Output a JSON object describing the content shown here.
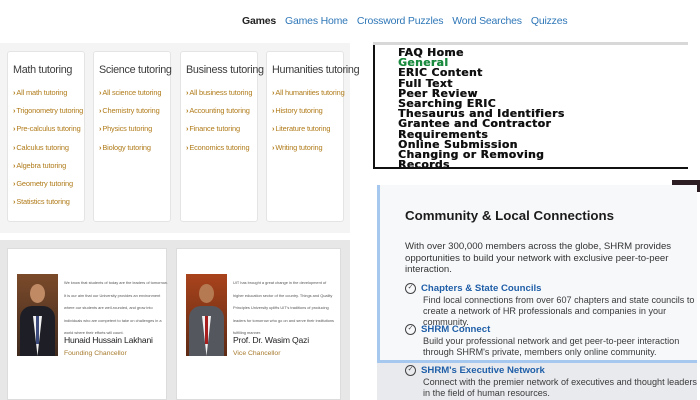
{
  "nav": {
    "items": [
      {
        "label": "Games",
        "active": true
      },
      {
        "label": "Games Home",
        "active": false
      },
      {
        "label": "Crossword Puzzles",
        "active": false
      },
      {
        "label": "Word Searches",
        "active": false
      },
      {
        "label": "Quizzes",
        "active": false
      }
    ]
  },
  "tutoring": [
    {
      "title": "Math tutoring",
      "links": [
        "All math tutoring",
        "Trigonometry tutoring",
        "Pre-calculus tutoring",
        "Calculus tutoring",
        "Algebra tutoring",
        "Geometry tutoring",
        "Statistics tutoring"
      ]
    },
    {
      "title": "Science tutoring",
      "links": [
        "All science tutoring",
        "Chemistry tutoring",
        "Physics tutoring",
        "Biology tutoring"
      ]
    },
    {
      "title": "Business tutoring",
      "links": [
        "All business tutoring",
        "Accounting tutoring",
        "Finance tutoring",
        "Economics tutoring"
      ]
    },
    {
      "title": "Humanities tutoring",
      "links": [
        "All humanities tutoring",
        "History tutoring",
        "Literature tutoring",
        "Writing tutoring"
      ]
    }
  ],
  "people": [
    {
      "quote": "We know that students of today are the leaders of tomorrow. It is our aim that our University provides an environment where our students are well-rounded, and grow into individuals who are competent to take on challenges in a world where their efforts will count.",
      "name": "Hunaid Hussain Lakhani",
      "role": "Founding Chancellor"
    },
    {
      "quote": "UIT has brought a great change in the development of higher education sector of the country. Things and Quality Principles University uplifts UIT's traditions of producing leaders for tomorrow who go on and serve their institutions fulfilling manner.",
      "name": "Prof. Dr. Wasim Qazi",
      "role": "Vice Chancellor"
    }
  ],
  "faq": {
    "items": [
      {
        "label": "FAQ Home",
        "active": false
      },
      {
        "label": "General",
        "active": true
      },
      {
        "label": "ERIC Content",
        "active": false
      },
      {
        "label": "Full Text",
        "active": false
      },
      {
        "label": "Peer Review",
        "active": false
      },
      {
        "label": "Searching ERIC",
        "active": false
      },
      {
        "label": "Thesaurus and Identifiers",
        "active": false
      },
      {
        "label": "Grantee and Contractor",
        "active": false
      },
      {
        "label": "Requirements",
        "active": false
      },
      {
        "label": "Online Submission",
        "active": false
      },
      {
        "label": "Changing or Removing",
        "active": false
      },
      {
        "label": "Records",
        "active": false
      }
    ]
  },
  "shrm": {
    "title": "Community & Local Connections",
    "intro": "With over 300,000 members across the globe, SHRM provides opportunities to build your network with exclusive peer-to-peer interaction.",
    "items": [
      {
        "label": "Chapters & State Councils",
        "desc": "Find local connections from over 607 chapters and state councils to create a network of HR professionals and companies in your community."
      },
      {
        "label": "SHRM Connect",
        "desc": "Build your professional network and get peer-to-peer interaction through SHRM's private, members only online community."
      },
      {
        "label": "SHRM's Executive Network",
        "desc": "Connect with the premier network of executives and thought leaders in the field of human resources."
      }
    ]
  },
  "colors": {
    "link": "#2f77b8",
    "tutor_link": "#b07b1a",
    "faq_active": "#1a8a3e",
    "shrm_link": "#1f5fa8",
    "shrm_border": "#a6c8ef"
  },
  "icons": {
    "shrm_item": "check-circle-icon",
    "tutor_link": "chevron-right-icon"
  }
}
